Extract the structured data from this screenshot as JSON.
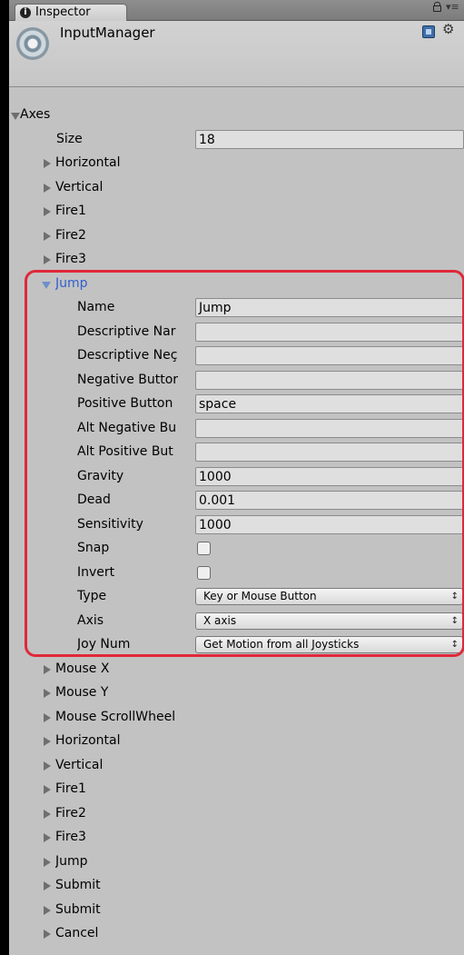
{
  "tab": {
    "title": "Inspector",
    "icon": "info-icon"
  },
  "header": {
    "object_name": "InputManager"
  },
  "axes": {
    "label": "Axes",
    "size_label": "Size",
    "size_value": "18",
    "before": [
      "Horizontal",
      "Vertical",
      "Fire1",
      "Fire2",
      "Fire3"
    ],
    "expanded": {
      "name": "Jump",
      "fields": [
        {
          "label": "Name",
          "type": "text",
          "value": "Jump"
        },
        {
          "label": "Descriptive Nar",
          "type": "text",
          "value": ""
        },
        {
          "label": "Descriptive Neç",
          "type": "text",
          "value": ""
        },
        {
          "label": "Negative Buttor",
          "type": "text",
          "value": ""
        },
        {
          "label": "Positive Button",
          "type": "text",
          "value": "space"
        },
        {
          "label": "Alt Negative Bu",
          "type": "text",
          "value": ""
        },
        {
          "label": "Alt Positive But",
          "type": "text",
          "value": ""
        },
        {
          "label": "Gravity",
          "type": "text",
          "value": "1000"
        },
        {
          "label": "Dead",
          "type": "text",
          "value": "0.001"
        },
        {
          "label": "Sensitivity",
          "type": "text",
          "value": "1000"
        },
        {
          "label": "Snap",
          "type": "checkbox",
          "checked": false
        },
        {
          "label": "Invert",
          "type": "checkbox",
          "checked": false
        },
        {
          "label": "Type",
          "type": "select",
          "value": "Key or Mouse Button"
        },
        {
          "label": "Axis",
          "type": "select",
          "value": "X axis"
        },
        {
          "label": "Joy Num",
          "type": "select",
          "value": "Get Motion from all Joysticks"
        }
      ]
    },
    "after": [
      "Mouse X",
      "Mouse Y",
      "Mouse ScrollWheel",
      "Horizontal",
      "Vertical",
      "Fire1",
      "Fire2",
      "Fire3",
      "Jump",
      "Submit",
      "Submit",
      "Cancel"
    ]
  },
  "colors": {
    "highlight": "#e0283a",
    "expanded_label": "#2f5fd0",
    "panel": "#c2c2c2"
  }
}
